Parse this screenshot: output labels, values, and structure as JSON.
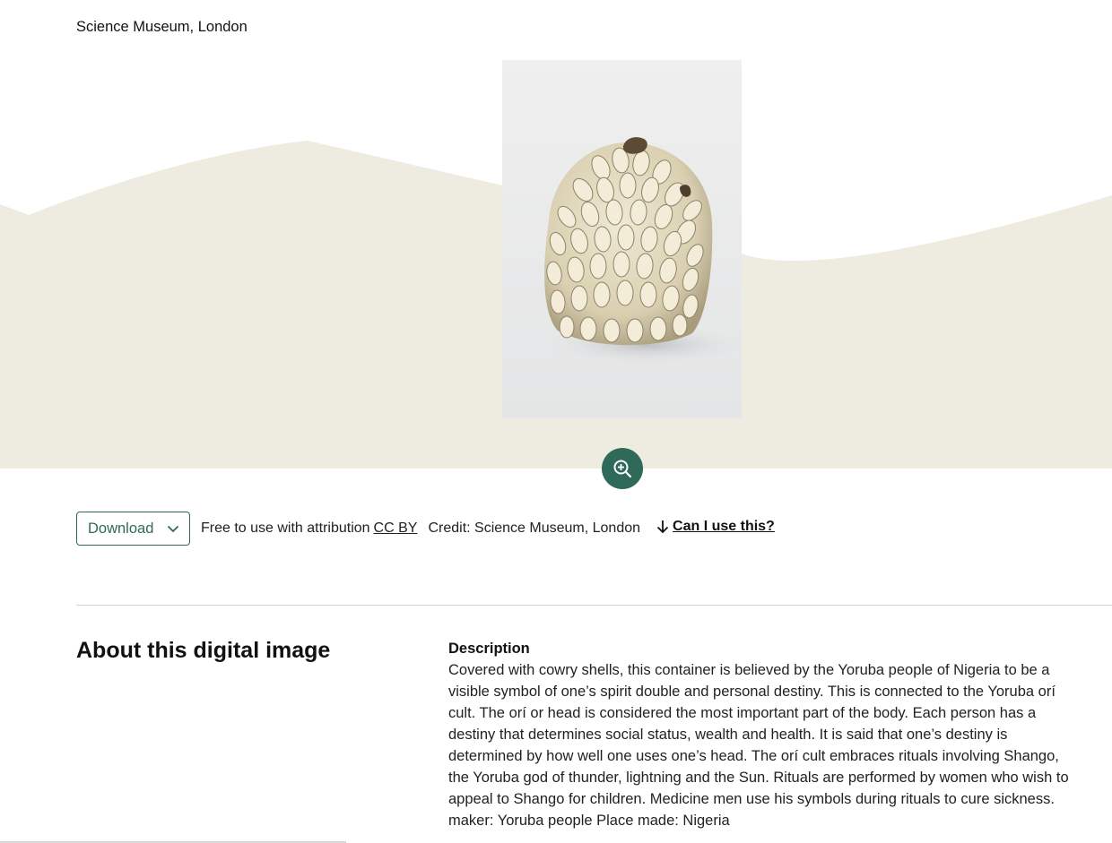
{
  "header": {
    "source": "Science Museum, London"
  },
  "image": {
    "alt": "Cowry shell covered container",
    "zoom_icon": "zoom-in-icon"
  },
  "rights": {
    "download_label": "Download",
    "download_icon": "chevron-down-icon",
    "license_prefix": "Free to use with attribution",
    "license_link": "CC BY",
    "credit": "Credit: Science Museum, London",
    "can_use_icon": "arrow-down-icon",
    "can_use_link": "Can I use this?"
  },
  "about": {
    "heading": "About this digital image",
    "description_label": "Description",
    "description": "Covered with cowry shells, this container is believed by the Yoruba people of Nigeria to be a visible symbol of one’s spirit double and personal destiny. This is connected to the Yoruba orí cult. The orí or head is considered the most important part of the body. Each person has a destiny that determines social status, wealth and health. It is said that one’s destiny is determined by how well one uses one’s head. The orí cult embraces rituals involving Shango, the Yoruba god of thunder, lightning and the Sun. Rituals are performed by women who wish to appeal to Shango for children. Medicine men use his symbols during rituals to cure sickness.",
    "maker": "maker: Yoruba people Place made: Nigeria"
  },
  "colors": {
    "accent": "#2f6a59",
    "wave": "#eeebe0"
  }
}
